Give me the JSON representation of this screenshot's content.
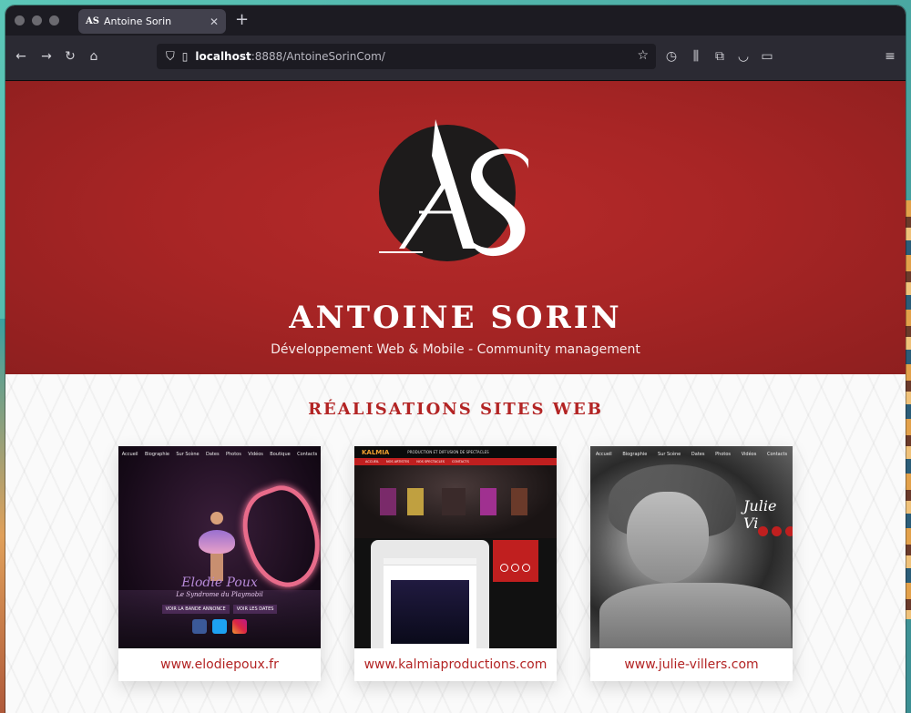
{
  "browser": {
    "tab_title": "Antoine Sorin",
    "tab_favicon": "AS",
    "new_tab_symbol": "+",
    "close_symbol": "✕",
    "url_host": "localhost",
    "url_rest": ":8888/AntoineSorinCom/",
    "icons": [
      "back-icon",
      "forward-icon",
      "reload-icon",
      "home-icon",
      "shield-icon",
      "page-icon",
      "bookmark-star-icon",
      "history-icon",
      "library-icon",
      "extensions-icon",
      "pocket-icon",
      "sidebar-icon",
      "menu-icon"
    ]
  },
  "hero": {
    "logo_letters": "AS",
    "name": "ANTOINE SORIN",
    "subtitle": "Développement Web & Mobile - Community management"
  },
  "section": {
    "title": "RÉALISATIONS SITES WEB"
  },
  "cards": [
    {
      "link": "www.elodiepoux.fr",
      "thumb_menu": [
        "Accueil",
        "Biographie",
        "Sur Scène",
        "Dates",
        "Photos",
        "Vidéos",
        "Boutique",
        "Contacts"
      ],
      "thumb_name": "Elodie Poux",
      "thumb_tagline": "Le Syndrome du Playmobil",
      "thumb_buttons": [
        "VOIR LA BANDE ANNONCE",
        "VOIR LES DATES"
      ]
    },
    {
      "link": "www.kalmiaproductions.com",
      "thumb_brand": "KALMIA",
      "thumb_tagline": "PRODUCTION ET DIFFUSION DE SPECTACLES",
      "thumb_menu": [
        "ACCUEIL",
        "NOS ARTISTES",
        "NOS SPECTACLES",
        "CONTACTS"
      ]
    },
    {
      "link": "www.julie-villers.com",
      "thumb_menu": [
        "Accueil",
        "Biographie",
        "Sur Scène",
        "Dates",
        "Photos",
        "Vidéos",
        "Contacts"
      ],
      "thumb_signature": "Julie Vi"
    }
  ],
  "colors": {
    "brand_red": "#b32424",
    "hero_red": "#a82525",
    "logo_dark": "#1d1b1b"
  }
}
